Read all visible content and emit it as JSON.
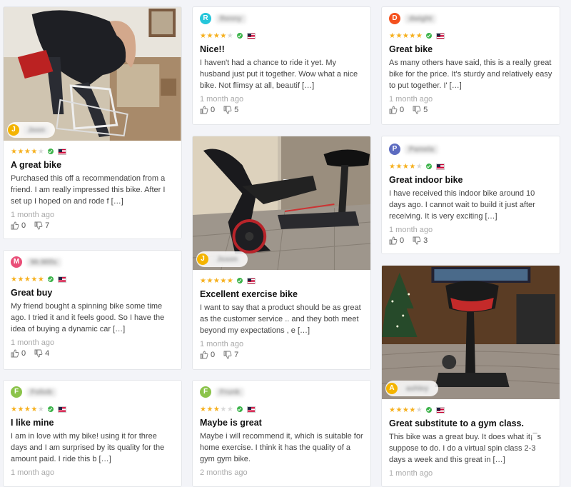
{
  "cards": [
    {
      "author_initial": "J",
      "author_name": "Joon",
      "avatar_color": "#f4b400",
      "rating": 4,
      "title": "A great bike",
      "text": "Purchased this off a recommendation from a friend. I am really impressed this bike. After I set up I hoped on and rode f […]",
      "date": "1 month ago",
      "likes": "0",
      "dislikes": "7",
      "photo": "Man assembling exercise bike"
    },
    {
      "author_initial": "M",
      "author_name": "Mr.Mills",
      "avatar_color": "#e94e77",
      "rating": 5,
      "title": "Great buy",
      "text": "My friend bought a spinning bike some time ago. I tried it and it feels good. So I have the idea of buying a dynamic car […]",
      "date": "1 month ago",
      "likes": "0",
      "dislikes": "4"
    },
    {
      "author_initial": "F",
      "author_name": "Foliob",
      "avatar_color": "#8bc34a",
      "rating": 4,
      "title": "I like mine",
      "text": "I am in love with my bike! using it for three days and I am surprised by its quality for the amount paid. I ride this b […]",
      "date": "1 month ago"
    },
    {
      "author_initial": "R",
      "author_name": "Renny",
      "avatar_color": "#26c6da",
      "rating": 4,
      "title": "Nice!!",
      "text": "I haven't had a chance to ride it yet. My husband just put it together. Wow what a nice bike. Not flimsy at all, beautif […]",
      "date": "1 month ago",
      "likes": "0",
      "dislikes": "5"
    },
    {
      "author_initial": "J",
      "author_name": "Jsson",
      "avatar_color": "#f4b400",
      "rating": 5,
      "title": "Excellent exercise bike",
      "text": "I want to say that a product should be as great as the customer service .. and they both meet beyond my expectations , e […]",
      "date": "1 month ago",
      "likes": "0",
      "dislikes": "7",
      "photo": "Black spinning bike on tiled floor"
    },
    {
      "author_initial": "F",
      "author_name": "Frunk",
      "avatar_color": "#8bc34a",
      "rating": 3,
      "title": "Maybe is great",
      "text": "Maybe i will recommend it, which is suitable for home exercise. I think it has the quality of a gym gym bike.",
      "date": "2 months ago"
    },
    {
      "author_initial": "D",
      "author_name": "dwight",
      "avatar_color": "#f4511e",
      "rating": 5,
      "title": "Great bike",
      "text": "As many others have said, this is a really great bike for the price. It's sturdy and relatively easy to put together. I' […]",
      "date": "1 month ago",
      "likes": "0",
      "dislikes": "5"
    },
    {
      "author_initial": "P",
      "author_name": "Pamela",
      "avatar_color": "#5c6bc0",
      "rating": 4,
      "title": "Great indoor bike",
      "text": "I have received this indoor bike around 10 days ago. I cannot wait to build it just after receiving. It is very exciting […]",
      "date": "1 month ago",
      "likes": "0",
      "dislikes": "3"
    },
    {
      "author_initial": "A",
      "author_name": "ashley",
      "avatar_color": "#f4b400",
      "rating": 4,
      "title": "Great substitute to a gym class.",
      "text": "This bike was a great buy. It does what it¡¯s suppose to do. I do a virtual spin class 2-3 days a week and this great in […]",
      "date": "1 month ago",
      "photo": "Exercise bike in living room with TV"
    }
  ],
  "colors": {
    "star": "#f6b01e",
    "star_off": "#d8d8d8",
    "verified": "#3cb34a",
    "page_bg": "#f3f4f8"
  }
}
